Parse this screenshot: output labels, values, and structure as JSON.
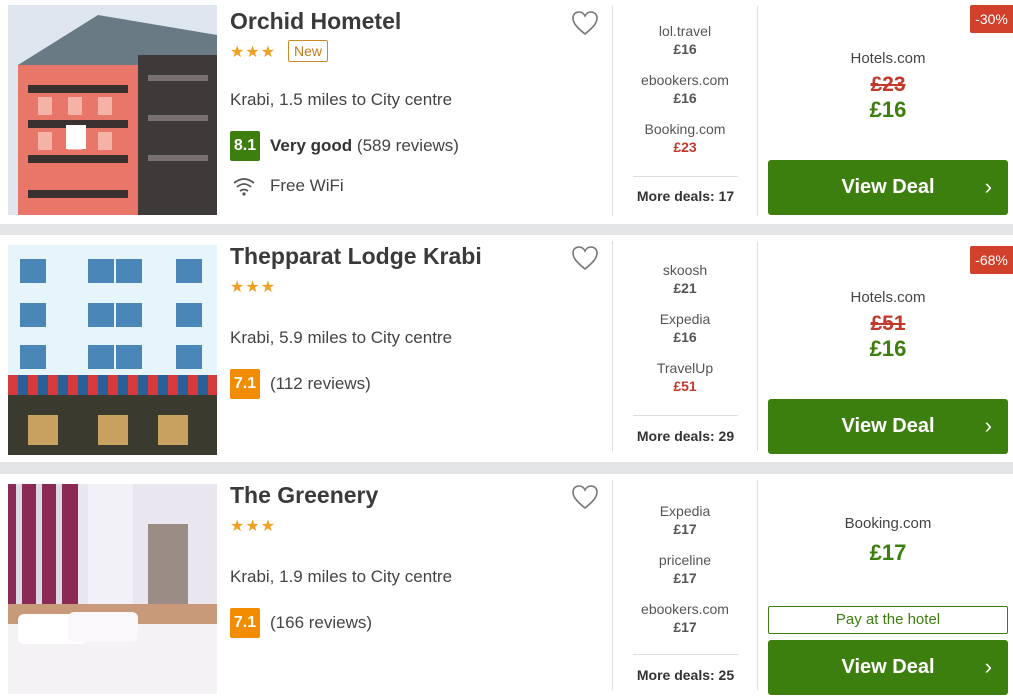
{
  "hotels": [
    {
      "name": "Orchid Hometel",
      "stars": "★★★",
      "badge": "New",
      "location": "Krabi, 1.5 miles to City centre",
      "score": "8.1",
      "score_label": "Very good",
      "reviews": "(589 reviews)",
      "amenity": "Free WiFi",
      "deals": [
        {
          "provider": "lol.travel",
          "price": "£16"
        },
        {
          "provider": "ebookers.com",
          "price": "£16"
        },
        {
          "provider": "Booking.com",
          "price": "£23"
        }
      ],
      "more_deals": "More deals: 17",
      "discount": "-30%",
      "best_provider": "Hotels.com",
      "old_price": "£23",
      "new_price": "£16",
      "button": "View Deal"
    },
    {
      "name": "Thepparat Lodge Krabi",
      "stars": "★★★",
      "location": "Krabi, 5.9 miles to City centre",
      "score": "7.1",
      "reviews": "(112 reviews)",
      "deals": [
        {
          "provider": "skoosh",
          "price": "£21"
        },
        {
          "provider": "Expedia",
          "price": "£16"
        },
        {
          "provider": "TravelUp",
          "price": "£51"
        }
      ],
      "more_deals": "More deals: 29",
      "discount": "-68%",
      "best_provider": "Hotels.com",
      "old_price": "£51",
      "new_price": "£16",
      "button": "View Deal"
    },
    {
      "name": "The Greenery",
      "stars": "★★★",
      "location": "Krabi, 1.9 miles to City centre",
      "score": "7.1",
      "reviews": "(166 reviews)",
      "deals": [
        {
          "provider": "Expedia",
          "price": "£17"
        },
        {
          "provider": "priceline",
          "price": "£17"
        },
        {
          "provider": "ebookers.com",
          "price": "£17"
        }
      ],
      "more_deals": "More deals: 25",
      "best_provider": "Booking.com",
      "new_price": "£17",
      "pay_note": "Pay at the hotel",
      "button": "View Deal"
    }
  ],
  "colors": {
    "accent_green": "#3d7f0f",
    "score_orange": "#f28c00",
    "discount_red": "#d0402b",
    "star_gold": "#f0a024"
  }
}
